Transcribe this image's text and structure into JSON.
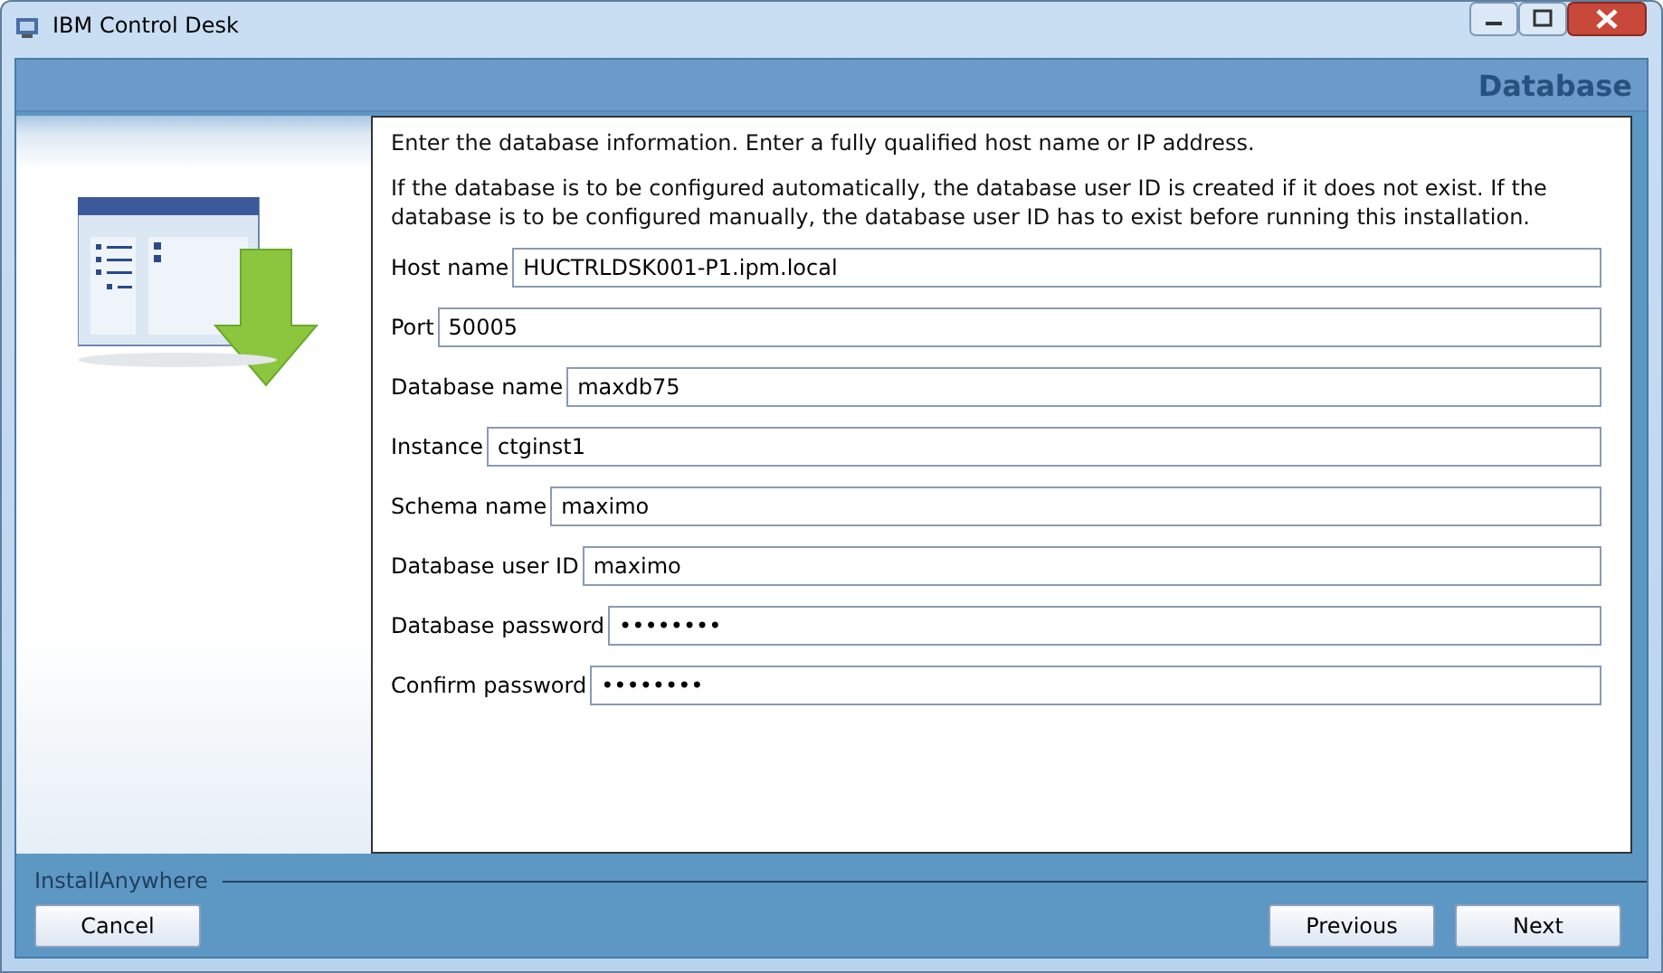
{
  "window": {
    "title": "IBM Control Desk"
  },
  "header": {
    "title": "Database"
  },
  "intro": [
    "Enter the database information. Enter a fully qualified host name or IP address.",
    "If the database is to be configured automatically, the database user ID is created if it does not exist. If the database is to be configured manually, the database user ID has to exist before running this installation."
  ],
  "fields": [
    {
      "label": "Host name",
      "value": "HUCTRLDSK001-P1.ipm.local"
    },
    {
      "label": "Port",
      "value": "50005"
    },
    {
      "label": "Database name",
      "value": "maxdb75"
    },
    {
      "label": "Instance",
      "value": "ctginst1"
    },
    {
      "label": "Schema name",
      "value": "maximo"
    },
    {
      "label": "Database user ID",
      "value": "maximo"
    },
    {
      "label": "Database password",
      "value": "••••••••"
    },
    {
      "label": "Confirm password",
      "value": "••••••••"
    }
  ],
  "footer": {
    "brand": "InstallAnywhere",
    "buttons": [
      {
        "label": "Cancel",
        "kind": "left"
      },
      {
        "label": "Previous",
        "kind": "right"
      },
      {
        "label": "Next",
        "kind": "right"
      }
    ]
  }
}
